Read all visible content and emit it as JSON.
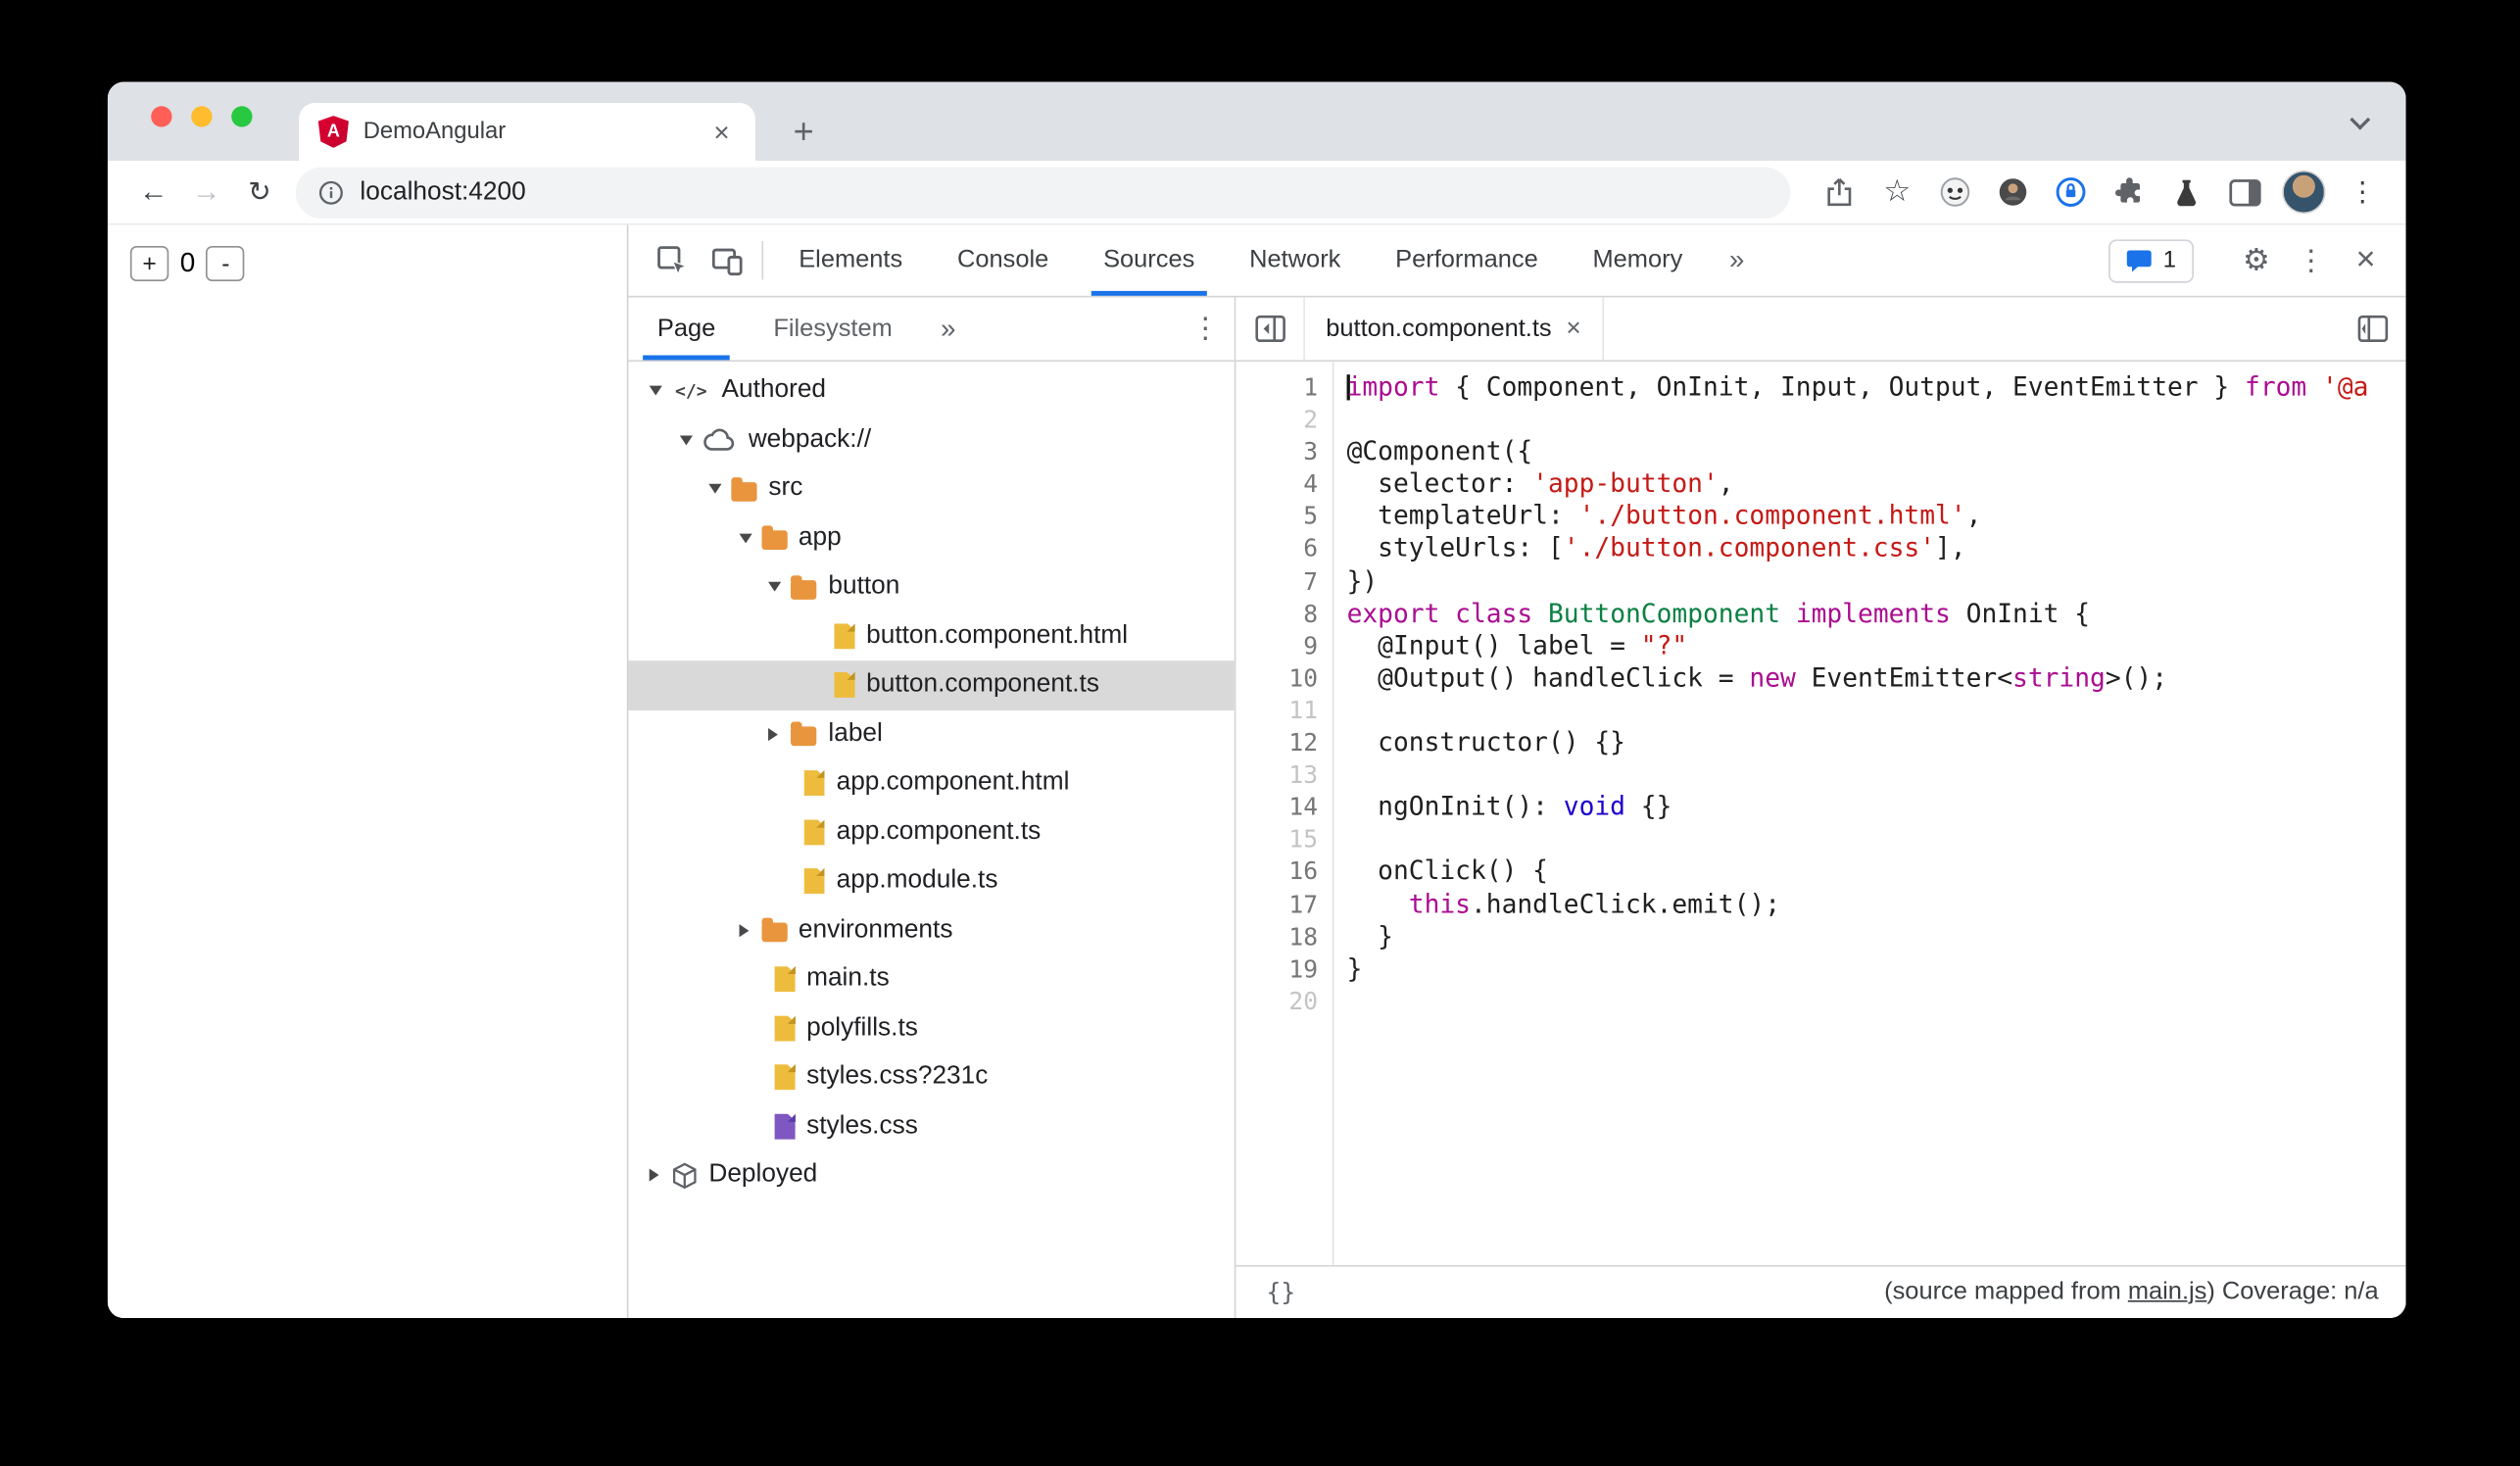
{
  "window": {
    "tab_title": "DemoAngular",
    "url": "localhost:4200"
  },
  "icons": {
    "new_tab": "+",
    "close": "×",
    "back": "←",
    "forward": "→",
    "reload": "↻",
    "star": "☆",
    "more": "»",
    "overflow": "⋮",
    "settings": "⚙",
    "brace": "{}"
  },
  "page": {
    "increment_label": "+",
    "counter_value": "0",
    "decrement_label": "-"
  },
  "devtools": {
    "toolbar": {
      "tabs": [
        "Elements",
        "Console",
        "Sources",
        "Network",
        "Performance",
        "Memory"
      ],
      "selected_tab": "Sources",
      "issues_count": "1"
    },
    "navigator": {
      "tabs": [
        "Page",
        "Filesystem"
      ],
      "selected_tab": "Page",
      "tree": [
        {
          "label": "Authored",
          "icon": "code",
          "state": "expanded",
          "depth": 0
        },
        {
          "label": "webpack://",
          "icon": "cloud",
          "state": "expanded",
          "depth": 1
        },
        {
          "label": "src",
          "icon": "folder",
          "state": "expanded",
          "depth": 2
        },
        {
          "label": "app",
          "icon": "folder",
          "state": "expanded",
          "depth": 3
        },
        {
          "label": "button",
          "icon": "folder",
          "state": "expanded",
          "depth": 4
        },
        {
          "label": "button.component.html",
          "icon": "file",
          "state": "leaf",
          "depth": 5
        },
        {
          "label": "button.component.ts",
          "icon": "file",
          "state": "leaf",
          "depth": 5,
          "selected": true
        },
        {
          "label": "label",
          "icon": "folder",
          "state": "collapsed",
          "depth": 4
        },
        {
          "label": "app.component.html",
          "icon": "file",
          "state": "leaf",
          "depth": 4
        },
        {
          "label": "app.component.ts",
          "icon": "file",
          "state": "leaf",
          "depth": 4
        },
        {
          "label": "app.module.ts",
          "icon": "file",
          "state": "leaf",
          "depth": 4
        },
        {
          "label": "environments",
          "icon": "folder",
          "state": "collapsed",
          "depth": 3
        },
        {
          "label": "main.ts",
          "icon": "file",
          "state": "leaf",
          "depth": 3
        },
        {
          "label": "polyfills.ts",
          "icon": "file",
          "state": "leaf",
          "depth": 3
        },
        {
          "label": "styles.css?231c",
          "icon": "file",
          "state": "leaf",
          "depth": 3
        },
        {
          "label": "styles.css",
          "icon": "css",
          "state": "leaf",
          "depth": 3
        },
        {
          "label": "Deployed",
          "icon": "package",
          "state": "collapsed",
          "depth": 0
        }
      ]
    },
    "editor": {
      "tab_label": "button.component.ts",
      "lines": [
        {
          "n": "1",
          "caret": true,
          "s": [
            {
              "t": "import",
              "c": "kw"
            },
            {
              "t": " { Component, OnInit, Input, Output, EventEmitter } ",
              "c": "p"
            },
            {
              "t": "from",
              "c": "kw"
            },
            {
              "t": " ",
              "c": "p"
            },
            {
              "t": "'@a",
              "c": "str"
            }
          ]
        },
        {
          "n": "2",
          "dim": true,
          "s": []
        },
        {
          "n": "3",
          "s": [
            {
              "t": "@Component({",
              "c": "p"
            }
          ]
        },
        {
          "n": "4",
          "s": [
            {
              "t": "  selector: ",
              "c": "p"
            },
            {
              "t": "'app-button'",
              "c": "str"
            },
            {
              "t": ",",
              "c": "p"
            }
          ]
        },
        {
          "n": "5",
          "s": [
            {
              "t": "  templateUrl: ",
              "c": "p"
            },
            {
              "t": "'./button.component.html'",
              "c": "str"
            },
            {
              "t": ",",
              "c": "p"
            }
          ]
        },
        {
          "n": "6",
          "s": [
            {
              "t": "  styleUrls: [",
              "c": "p"
            },
            {
              "t": "'./button.component.css'",
              "c": "str"
            },
            {
              "t": "],",
              "c": "p"
            }
          ]
        },
        {
          "n": "7",
          "s": [
            {
              "t": "})",
              "c": "p"
            }
          ]
        },
        {
          "n": "8",
          "s": [
            {
              "t": "export class",
              "c": "kw"
            },
            {
              "t": " ",
              "c": "p"
            },
            {
              "t": "ButtonComponent",
              "c": "type"
            },
            {
              "t": " ",
              "c": "p"
            },
            {
              "t": "implements",
              "c": "kw"
            },
            {
              "t": " OnInit {",
              "c": "p"
            }
          ]
        },
        {
          "n": "9",
          "s": [
            {
              "t": "  @Input() label = ",
              "c": "p"
            },
            {
              "t": "\"?\"",
              "c": "str"
            }
          ]
        },
        {
          "n": "10",
          "s": [
            {
              "t": "  @Output() handleClick = ",
              "c": "p"
            },
            {
              "t": "new",
              "c": "kw"
            },
            {
              "t": " EventEmitter<",
              "c": "p"
            },
            {
              "t": "string",
              "c": "kw"
            },
            {
              "t": ">();",
              "c": "p"
            }
          ]
        },
        {
          "n": "11",
          "dim": true,
          "s": []
        },
        {
          "n": "12",
          "s": [
            {
              "t": "  constructor() {}",
              "c": "p"
            }
          ]
        },
        {
          "n": "13",
          "dim": true,
          "s": []
        },
        {
          "n": "14",
          "s": [
            {
              "t": "  ngOnInit(): ",
              "c": "p"
            },
            {
              "t": "void",
              "c": "blt"
            },
            {
              "t": " {}",
              "c": "p"
            }
          ]
        },
        {
          "n": "15",
          "dim": true,
          "s": []
        },
        {
          "n": "16",
          "s": [
            {
              "t": "  onClick() {",
              "c": "p"
            }
          ]
        },
        {
          "n": "17",
          "s": [
            {
              "t": "    ",
              "c": "p"
            },
            {
              "t": "this",
              "c": "kw"
            },
            {
              "t": ".handleClick.emit();",
              "c": "p"
            }
          ]
        },
        {
          "n": "18",
          "s": [
            {
              "t": "  }",
              "c": "p"
            }
          ]
        },
        {
          "n": "19",
          "s": [
            {
              "t": "}",
              "c": "p"
            }
          ]
        },
        {
          "n": "20",
          "dim": true,
          "s": []
        }
      ],
      "status": {
        "text_prefix": "(source mapped from ",
        "link": "main.js",
        "text_suffix": ") Coverage: n/a"
      }
    },
    "colors": {
      "accent_blue": "#1a73e8",
      "keyword": "#aa0d91",
      "string": "#c41a16",
      "type_name": "#0b8043",
      "builtin_type": "#1c00cf",
      "folder_icon": "#e8953e",
      "file_icon": "#eebc3d",
      "css_file_icon": "#7e57c2"
    }
  }
}
